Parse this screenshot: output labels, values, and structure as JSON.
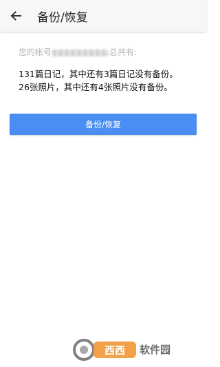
{
  "appbar": {
    "title": "备份/恢复",
    "back_icon": "arrow-left-icon"
  },
  "account": {
    "prefix": "您的帐号",
    "suffix": "总共有:"
  },
  "stats": {
    "diary_line": "131篇日记，其中还有3篇日记没有备份。",
    "photo_line": "26张照片，其中还有4张照片没有备份。"
  },
  "actions": {
    "backup_restore_label": "备份/恢复"
  },
  "colors": {
    "accent": "#4a8ef3",
    "appbar_bg": "#f7f7f7"
  },
  "watermark": {
    "text": "西西软件园"
  }
}
